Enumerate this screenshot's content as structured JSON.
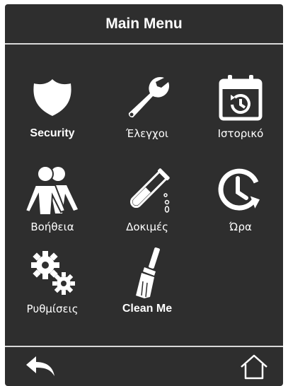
{
  "header": {
    "title": "Main Menu"
  },
  "tiles": [
    {
      "label": "Security",
      "icon": "shield-icon"
    },
    {
      "label": "Έλεγχοι",
      "icon": "wrench-icon"
    },
    {
      "label": "Ιστορικό",
      "icon": "calendar-history-icon"
    },
    {
      "label": "Βοήθεια",
      "icon": "people-icon"
    },
    {
      "label": "Δοκιμές",
      "icon": "test-tube-icon"
    },
    {
      "label": "Ώρα",
      "icon": "clock-refresh-icon"
    },
    {
      "label": "Ρυθμίσεις",
      "icon": "gears-icon"
    },
    {
      "label": "Clean Me",
      "icon": "brush-icon"
    }
  ],
  "footer": {
    "back_icon": "back-arrow-icon",
    "home_icon": "home-icon"
  },
  "colors": {
    "background": "#2e2e2e",
    "foreground": "#ffffff",
    "divider": "#d9d9d9"
  }
}
